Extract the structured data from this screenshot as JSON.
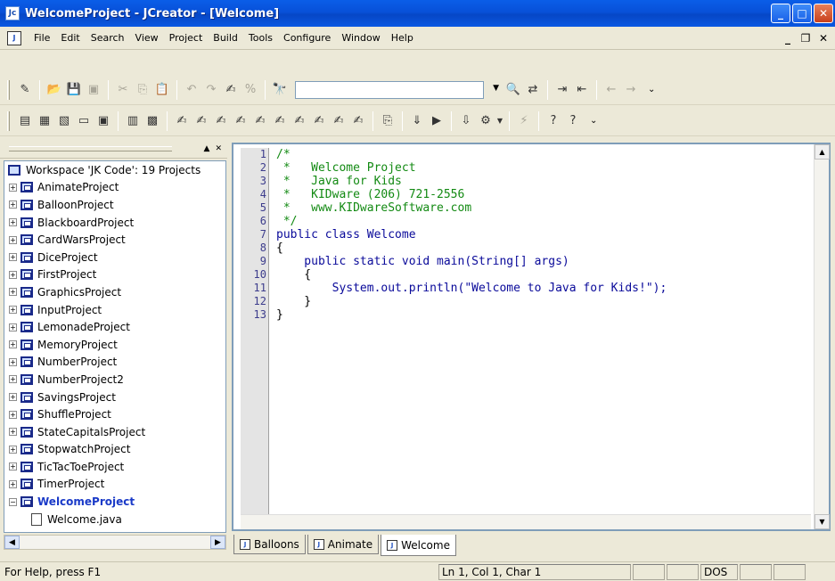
{
  "window": {
    "title": "WelcomeProject - JCreator - [Welcome]",
    "app_icon_letter": "Jc"
  },
  "menu": [
    "File",
    "Edit",
    "Search",
    "View",
    "Project",
    "Build",
    "Tools",
    "Configure",
    "Window",
    "Help"
  ],
  "workspace": {
    "title": "Workspace 'JK Code': 19 Projects",
    "projects": [
      "AnimateProject",
      "BalloonProject",
      "BlackboardProject",
      "CardWarsProject",
      "DiceProject",
      "FirstProject",
      "GraphicsProject",
      "InputProject",
      "LemonadeProject",
      "MemoryProject",
      "NumberProject",
      "NumberProject2",
      "SavingsProject",
      "ShuffleProject",
      "StateCapitalsProject",
      "StopwatchProject",
      "TicTacToeProject",
      "TimerProject"
    ],
    "active_project": "WelcomeProject",
    "active_file": "Welcome.java"
  },
  "editor": {
    "lines": [
      {
        "n": "1",
        "text": "/*",
        "cls": "c-comment"
      },
      {
        "n": "2",
        "text": " *   Welcome Project",
        "cls": "c-comment"
      },
      {
        "n": "3",
        "text": " *   Java for Kids",
        "cls": "c-comment"
      },
      {
        "n": "4",
        "text": " *   KIDware (206) 721-2556",
        "cls": "c-comment"
      },
      {
        "n": "5",
        "text": " *   www.KIDwareSoftware.com",
        "cls": "c-comment"
      },
      {
        "n": "6",
        "text": " */",
        "cls": "c-comment"
      },
      {
        "n": "7",
        "text": "public class Welcome",
        "cls": "c-kw"
      },
      {
        "n": "8",
        "text": "{",
        "cls": ""
      },
      {
        "n": "9",
        "text": "    public static void main(String[] args)",
        "cls": "c-kw"
      },
      {
        "n": "10",
        "text": "    {",
        "cls": ""
      },
      {
        "n": "11",
        "text": "        System.out.println(\"Welcome to Java for Kids!\");",
        "cls": "c-str"
      },
      {
        "n": "12",
        "text": "    }",
        "cls": ""
      },
      {
        "n": "13",
        "text": "}",
        "cls": ""
      }
    ]
  },
  "tabs": [
    {
      "label": "Balloons",
      "active": false
    },
    {
      "label": "Animate",
      "active": false
    },
    {
      "label": "Welcome",
      "active": true
    }
  ],
  "status": {
    "help": "For Help, press F1",
    "position": "Ln 1, Col 1, Char 1",
    "format": "DOS"
  },
  "colors": {
    "title_blue": "#0A5EE8",
    "comment_green": "#138A13",
    "keyword_blue": "#0A0A9A"
  }
}
